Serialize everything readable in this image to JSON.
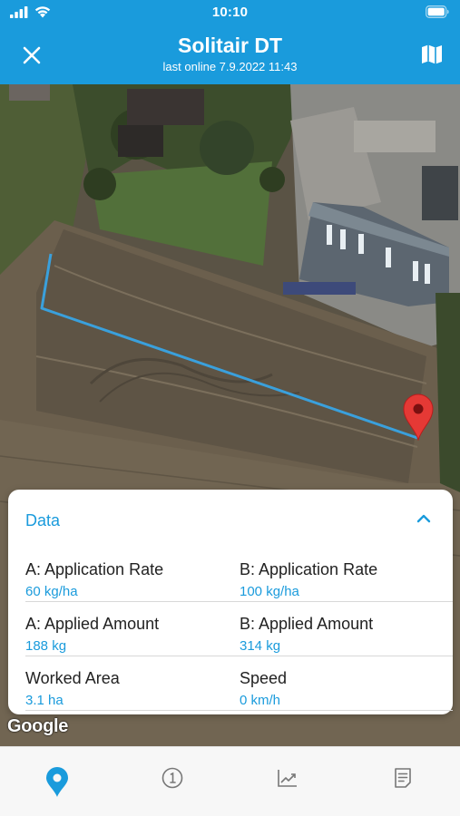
{
  "status_bar": {
    "time": "10:10",
    "icons": [
      "signal-icon",
      "wifi-icon",
      "battery-icon"
    ]
  },
  "header": {
    "title": "Solitair DT",
    "subtitle": "last online 7.9.2022 11:43",
    "left_icon": "close-icon",
    "right_icon": "map-icon"
  },
  "map": {
    "attribution": "Google",
    "marker_icon": "location-pin-icon",
    "track_color": "#3aa0dc",
    "marker_color": "#e53935"
  },
  "data_panel": {
    "title": "Data",
    "toggle_icon": "chevron-up-icon",
    "rows": [
      {
        "left": {
          "label": "A: Application Rate",
          "value": "60 kg/ha"
        },
        "right": {
          "label": "B: Application Rate",
          "value": "100 kg/ha"
        }
      },
      {
        "left": {
          "label": "A: Applied Amount",
          "value": "188 kg"
        },
        "right": {
          "label": "B: Applied Amount",
          "value": "314 kg"
        }
      },
      {
        "left": {
          "label": "Worked Area",
          "value": "3.1 ha"
        },
        "right": {
          "label": "Speed",
          "value": "0 km/h"
        }
      }
    ]
  },
  "bottom_nav": {
    "items": [
      {
        "icon": "location-pin-icon",
        "active": true
      },
      {
        "icon": "info-icon",
        "active": false
      },
      {
        "icon": "chart-icon",
        "active": false
      },
      {
        "icon": "document-icon",
        "active": false
      }
    ]
  },
  "colors": {
    "accent": "#1a9bdc",
    "text": "#222222",
    "nav_background": "#f7f7f7"
  }
}
